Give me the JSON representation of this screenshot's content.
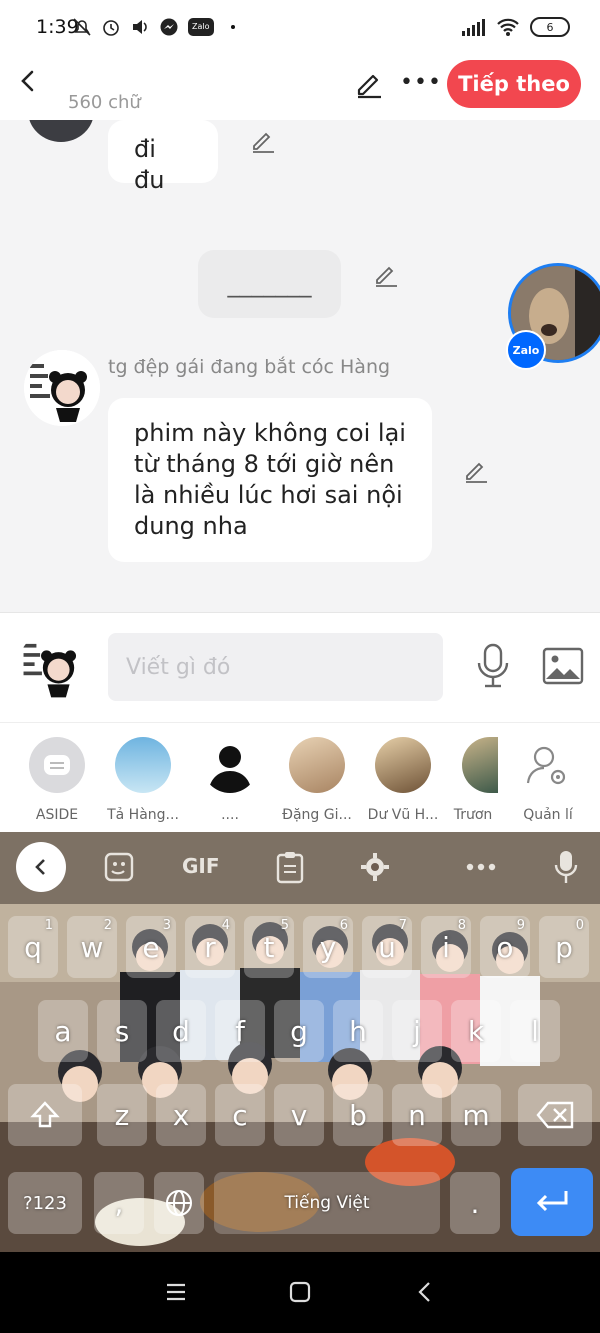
{
  "status_bar": {
    "time": "1:39",
    "zalo": "Zalo",
    "battery": "6"
  },
  "header": {
    "char_count": "560 chữ",
    "next_label": "Tiếp theo",
    "more_label": "•••"
  },
  "chat": {
    "messages": [
      {
        "text": "đi đu"
      },
      {
        "text": "_______"
      },
      {
        "text": "phim này không coi lại từ tháng 8 tới giờ nên là nhiều lúc hơi sai nội dung nha"
      }
    ],
    "sender_name": "tg đệp gái đang bắt cóc Hàng",
    "floating_badge": "Zalo"
  },
  "composer": {
    "placeholder": "Viết gì đó"
  },
  "share_targets": [
    {
      "label": "ASIDE",
      "color": "#d9d9dc"
    },
    {
      "label": "Tả Hàng...",
      "color": "#5aa7d6"
    },
    {
      "label": "....",
      "color": "#1a1a1a"
    },
    {
      "label": "Đặng Gi...",
      "color": "#c9a98a"
    },
    {
      "label": "Dư Vũ H...",
      "color": "#a8865e"
    },
    {
      "label": "Trươn",
      "color": "#6b8d77"
    },
    {
      "label": "Quản lí",
      "color": "#ffffff"
    }
  ],
  "keyboard": {
    "toolbar": {
      "gif": "GIF"
    },
    "row1": [
      {
        "key": "q",
        "num": "1"
      },
      {
        "key": "w",
        "num": "2"
      },
      {
        "key": "e",
        "num": "3"
      },
      {
        "key": "r",
        "num": "4"
      },
      {
        "key": "t",
        "num": "5"
      },
      {
        "key": "y",
        "num": "6"
      },
      {
        "key": "u",
        "num": "7"
      },
      {
        "key": "i",
        "num": "8"
      },
      {
        "key": "o",
        "num": "9"
      },
      {
        "key": "p",
        "num": "0"
      }
    ],
    "row2": [
      "a",
      "s",
      "d",
      "f",
      "g",
      "h",
      "j",
      "k",
      "l"
    ],
    "row3": [
      "z",
      "x",
      "c",
      "v",
      "b",
      "n",
      "m"
    ],
    "symbols_label": "?123",
    "space_label": "Tiếng Việt"
  }
}
